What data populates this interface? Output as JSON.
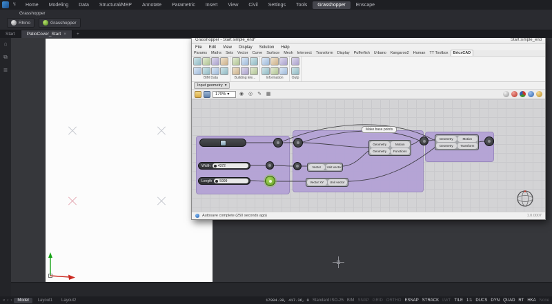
{
  "colors": {
    "accent_green": "#84c93d",
    "group_purple": "#b2a0d6",
    "gh_canvas_gray": "#d3d3d5",
    "dark_ui": "#1e1f23"
  },
  "app": {
    "menu_tabs": [
      {
        "label": "Home"
      },
      {
        "label": "Modeling"
      },
      {
        "label": "Data"
      },
      {
        "label": "Structural/MEP"
      },
      {
        "label": "Annotate"
      },
      {
        "label": "Parametric"
      },
      {
        "label": "Insert"
      },
      {
        "label": "View"
      },
      {
        "label": "Civil"
      },
      {
        "label": "Settings"
      },
      {
        "label": "Tools"
      },
      {
        "label": "Grasshopper",
        "active": true
      },
      {
        "label": "Enscape"
      }
    ],
    "ribbon_panel_label": "Grasshopper",
    "ribbon_buttons": [
      {
        "label": "Rhino"
      },
      {
        "label": "Grasshopper"
      }
    ],
    "doc_tabs": {
      "inactive": "Start",
      "active": "PatioCover_Start",
      "close_glyph": "×",
      "new_tab_glyph": "+"
    }
  },
  "gh": {
    "title": "Grasshopper - Start simple_end*",
    "doc_name": "Start simple_end",
    "menus": [
      {
        "label": "File"
      },
      {
        "label": "Edit"
      },
      {
        "label": "View"
      },
      {
        "label": "Display"
      },
      {
        "label": "Solution"
      },
      {
        "label": "Help"
      }
    ],
    "tabs": [
      {
        "label": "Params"
      },
      {
        "label": "Maths"
      },
      {
        "label": "Sets"
      },
      {
        "label": "Vector"
      },
      {
        "label": "Curve"
      },
      {
        "label": "Surface"
      },
      {
        "label": "Mesh"
      },
      {
        "label": "Intersect"
      },
      {
        "label": "Transform"
      },
      {
        "label": "Display"
      },
      {
        "label": "Pufferfish"
      },
      {
        "label": "Urbano"
      },
      {
        "label": "Kangaroo2"
      },
      {
        "label": "Human"
      },
      {
        "label": "TT Toolbox"
      },
      {
        "label": "BricsCAD",
        "active": true
      }
    ],
    "ribbon_groups": [
      {
        "label": "BIM Data"
      },
      {
        "label": "Building Ele..."
      },
      {
        "label": "Information"
      },
      {
        "label": "Outp"
      }
    ],
    "input_dropdown": "Input geometry",
    "toolbar": {
      "zoom": "170%"
    },
    "canvas": {
      "group_label": "Make base points",
      "sliders": {
        "width": {
          "label": "Width",
          "value": "4372"
        },
        "length": {
          "label": "Length",
          "value": "5999"
        }
      },
      "move1": {
        "r1c1": "Geometry",
        "r1c2": "Motion",
        "r2c1": "Geometry",
        "r2c2": "Functions"
      },
      "move2": {
        "r1c1": "Geometry",
        "r1c2": "Motion",
        "r2c1": "Geometry",
        "r2c2": "Transform"
      },
      "vec1": {
        "c1": "Vector",
        "c2": "Unit vector"
      },
      "vec2": {
        "c1": "Vector XY",
        "c2": "Unit vector"
      }
    },
    "status": "Autosave complete (250 seconds ago)",
    "version": "1.0.0007"
  },
  "statusbar": {
    "layout_tabs": [
      {
        "label": "Model",
        "active": true
      },
      {
        "label": "Layout1"
      },
      {
        "label": "Layout2"
      }
    ],
    "coords": "17984.38, 417.36, 0",
    "style": "Standard ISO-25",
    "workspace": "BIM",
    "toggles": [
      {
        "label": "SNAP"
      },
      {
        "label": "GRID"
      },
      {
        "label": "ORTHO"
      },
      {
        "label": "ESNAP",
        "on": true
      },
      {
        "label": "STRACK",
        "on": true
      },
      {
        "label": "LWT"
      },
      {
        "label": "TILE",
        "on": true
      },
      {
        "label": "1:1",
        "on": true
      },
      {
        "label": "DUCS",
        "on": true
      },
      {
        "label": "DYN",
        "on": true
      },
      {
        "label": "QUAD",
        "on": true
      },
      {
        "label": "RT",
        "on": true
      },
      {
        "label": "HKA",
        "on": true
      },
      {
        "label": "None"
      }
    ]
  }
}
